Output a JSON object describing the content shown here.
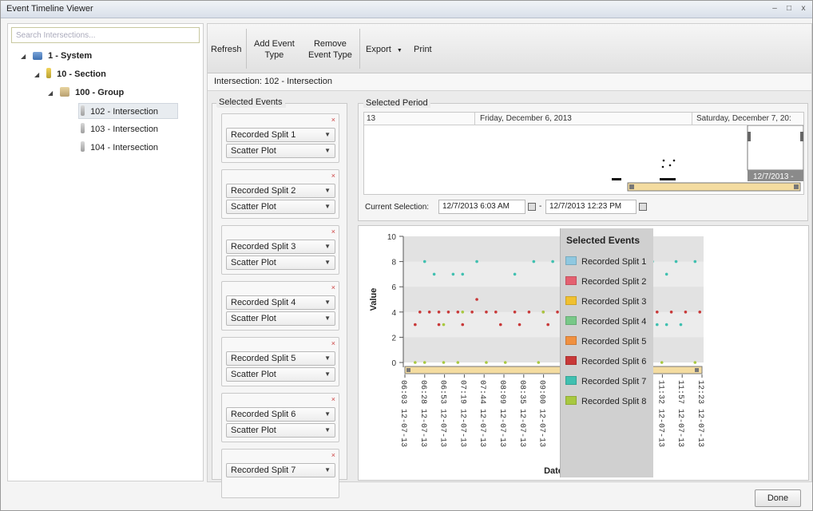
{
  "window": {
    "title": "Event Timeline Viewer",
    "controls": [
      "–",
      "□",
      "x"
    ]
  },
  "sidebar": {
    "search_placeholder": "Search Intersections...",
    "tree": [
      {
        "label": "1 - System",
        "expander": "◢"
      },
      {
        "label": "10 - Section",
        "expander": "◢"
      },
      {
        "label": "100 - Group",
        "expander": "◢"
      },
      {
        "label": "102 - Intersection",
        "selected": true
      },
      {
        "label": "103 - Intersection"
      },
      {
        "label": "104 - Intersection"
      }
    ]
  },
  "toolbar": {
    "refresh": "Refresh",
    "add_event_type_1": "Add Event",
    "add_event_type_2": "Type",
    "remove_event_type_1": "Remove",
    "remove_event_type_2": "Event Type",
    "export": "Export",
    "export_arrow": "▼",
    "print": "Print"
  },
  "intersection_label": "Intersection: 102 - Intersection",
  "selected_events": {
    "title": "Selected Events",
    "close_glyph": "×",
    "combo_arrow": "▼",
    "cards": [
      {
        "event": "Recorded Split 1",
        "plot": "Scatter Plot"
      },
      {
        "event": "Recorded Split 2",
        "plot": "Scatter Plot"
      },
      {
        "event": "Recorded Split 3",
        "plot": "Scatter Plot"
      },
      {
        "event": "Recorded Split 4",
        "plot": "Scatter Plot"
      },
      {
        "event": "Recorded Split 5",
        "plot": "Scatter Plot"
      },
      {
        "event": "Recorded Split 6",
        "plot": "Scatter Plot"
      },
      {
        "event": "Recorded Split 7"
      }
    ]
  },
  "selected_period": {
    "title": "Selected Period",
    "date_left": "13",
    "date_mid": "Friday, December 6, 2013",
    "date_right": "Saturday, December 7, 20:",
    "window_label": "12/7/2013 -",
    "current_selection_label": "Current Selection:",
    "start": "12/7/2013 6:03 AM",
    "dash": "-",
    "end": "12/7/2013 12:23 PM"
  },
  "chart_data": {
    "type": "scatter",
    "ylabel": "Value",
    "xlabel": "Date",
    "ylim": [
      0,
      10
    ],
    "yticks": [
      0,
      2,
      4,
      6,
      8,
      10
    ],
    "x_ticks": [
      "06:03 12-07-13",
      "06:28 12-07-13",
      "06:53 12-07-13",
      "07:19 12-07-13",
      "07:44 12-07-13",
      "08:09 12-07-13",
      "08:35 12-07-13",
      "09:00 12-07-13",
      "09:25 12-07-13",
      "09:51 12-07-13",
      "10:16 12-07-13",
      "10:41 12-07-13",
      "11:07 12-07-13",
      "11:32 12-07-13",
      "11:57 12-07-13",
      "12:23 12-07-13"
    ],
    "legend_title": "Selected Events",
    "series": [
      {
        "name": "Recorded Split 1",
        "color": "#8fc8e0",
        "values": []
      },
      {
        "name": "Recorded Split 2",
        "color": "#e46070",
        "values": []
      },
      {
        "name": "Recorded Split 3",
        "color": "#f0c030",
        "values": []
      },
      {
        "name": "Recorded Split 4",
        "color": "#78c888",
        "values": []
      },
      {
        "name": "Recorded Split 5",
        "color": "#f09040",
        "values": []
      },
      {
        "name": "Recorded Split 6",
        "color": "#c83838",
        "values": [
          [
            6.4,
            4
          ],
          [
            6.6,
            4
          ],
          [
            6.8,
            4
          ],
          [
            7.0,
            4
          ],
          [
            7.2,
            4
          ],
          [
            7.5,
            4
          ],
          [
            7.8,
            4
          ],
          [
            8.0,
            4
          ],
          [
            8.4,
            4
          ],
          [
            8.7,
            4
          ],
          [
            9.0,
            4
          ],
          [
            9.3,
            4
          ],
          [
            9.6,
            4
          ],
          [
            9.9,
            4
          ],
          [
            10.2,
            4
          ],
          [
            10.5,
            4
          ],
          [
            10.8,
            4
          ],
          [
            11.1,
            4
          ],
          [
            11.4,
            4
          ],
          [
            11.7,
            4
          ],
          [
            12.0,
            4
          ],
          [
            12.3,
            4
          ],
          [
            6.3,
            3
          ],
          [
            6.8,
            3
          ],
          [
            7.3,
            3
          ],
          [
            7.6,
            5
          ],
          [
            8.1,
            3
          ],
          [
            8.5,
            3
          ],
          [
            9.1,
            3
          ],
          [
            10.4,
            2
          ]
        ]
      },
      {
        "name": "Recorded Split 7",
        "color": "#40c0b0",
        "values": [
          [
            6.5,
            8
          ],
          [
            7.6,
            8
          ],
          [
            8.8,
            8
          ],
          [
            9.2,
            8
          ],
          [
            9.5,
            8
          ],
          [
            9.6,
            8
          ],
          [
            10.0,
            8
          ],
          [
            10.5,
            8
          ],
          [
            10.9,
            8
          ],
          [
            11.2,
            8
          ],
          [
            11.3,
            8
          ],
          [
            11.8,
            8
          ],
          [
            12.2,
            8
          ],
          [
            6.7,
            7
          ],
          [
            7.1,
            7
          ],
          [
            7.3,
            7
          ],
          [
            8.4,
            7
          ],
          [
            9.4,
            7
          ],
          [
            10.0,
            7
          ],
          [
            10.8,
            7
          ],
          [
            10.9,
            7
          ],
          [
            11.0,
            7
          ],
          [
            11.1,
            7
          ],
          [
            11.6,
            7
          ],
          [
            10.9,
            3
          ],
          [
            11.4,
            3
          ],
          [
            11.6,
            3
          ],
          [
            11.9,
            3
          ]
        ]
      },
      {
        "name": "Recorded Split 8",
        "color": "#a8c840",
        "values": [
          [
            6.3,
            0
          ],
          [
            6.5,
            0
          ],
          [
            6.9,
            0
          ],
          [
            7.2,
            0
          ],
          [
            7.8,
            0
          ],
          [
            8.2,
            0
          ],
          [
            8.9,
            0
          ],
          [
            9.6,
            0
          ],
          [
            10.1,
            0
          ],
          [
            10.7,
            0
          ],
          [
            11.5,
            0
          ],
          [
            12.2,
            0
          ],
          [
            6.9,
            3
          ],
          [
            7.3,
            4
          ],
          [
            9.0,
            4
          ],
          [
            10.2,
            3
          ]
        ]
      }
    ]
  },
  "done_button": "Done"
}
